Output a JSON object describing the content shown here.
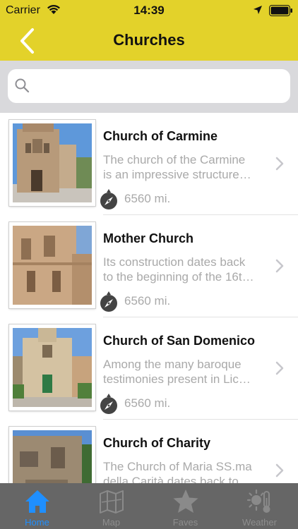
{
  "status_bar": {
    "carrier": "Carrier",
    "time": "14:39"
  },
  "nav": {
    "title": "Churches"
  },
  "search": {
    "placeholder": "",
    "value": ""
  },
  "churches": [
    {
      "name": "Church of Carmine",
      "desc_line1": "The church of the Carmine",
      "desc_line2": "is an impressive structure…",
      "distance": "6560 mi."
    },
    {
      "name": "Mother Church",
      "desc_line1": "Its construction dates back",
      "desc_line2": "to the beginning of the 16t…",
      "distance": "6560 mi."
    },
    {
      "name": "Church of San Domenico",
      "desc_line1": "Among the many baroque",
      "desc_line2": "testimonies present in Lic…",
      "distance": "6560 mi."
    },
    {
      "name": "Church of Charity",
      "desc_line1": "The Church of Maria SS.ma",
      "desc_line2": "della Carità dates back to…",
      "distance": ""
    }
  ],
  "tabs": [
    {
      "label": "Home",
      "icon": "home-icon",
      "active": true
    },
    {
      "label": "Map",
      "icon": "map-icon",
      "active": false
    },
    {
      "label": "Faves",
      "icon": "star-icon",
      "active": false
    },
    {
      "label": "Weather",
      "icon": "weather-icon",
      "active": false
    }
  ],
  "colors": {
    "accent": "#e3d22a",
    "tab_bar": "#666666",
    "active_tab": "#1f8fff",
    "muted_text": "#a9a9a9"
  }
}
